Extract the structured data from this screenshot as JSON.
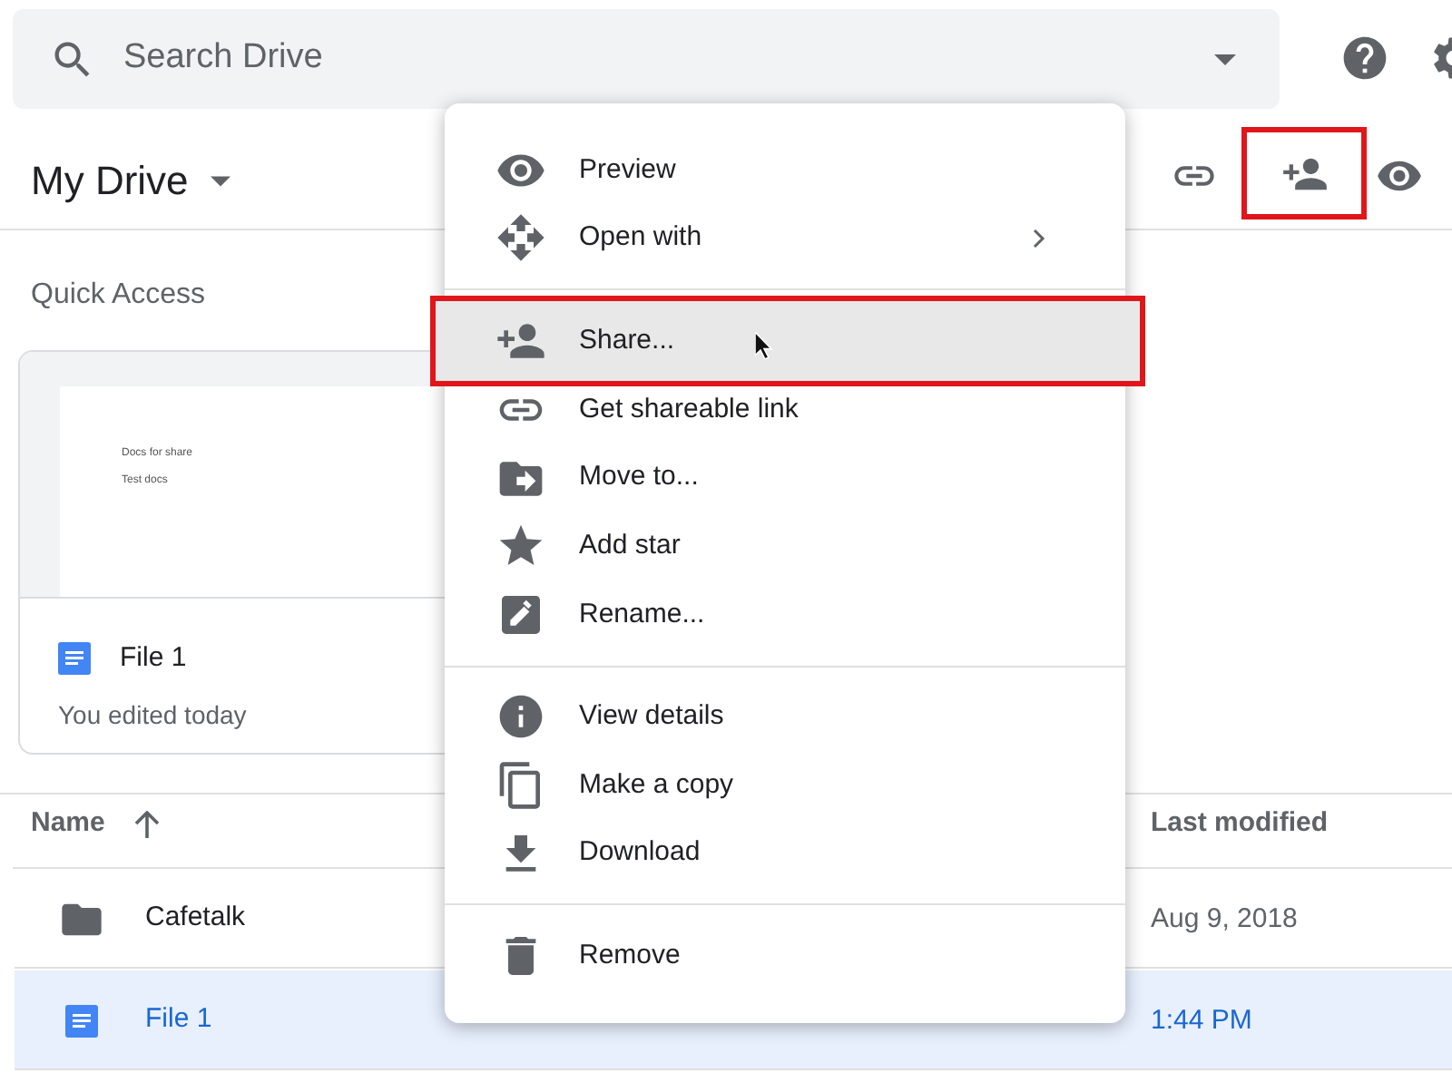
{
  "search": {
    "placeholder": "Search Drive"
  },
  "header_actions": [
    {
      "kind": "help"
    },
    {
      "kind": "settings"
    }
  ],
  "title": "My Drive",
  "toolbar": [
    {
      "kind": "link",
      "highlighted": false
    },
    {
      "kind": "share",
      "highlighted": true
    },
    {
      "kind": "preview",
      "highlighted": false
    }
  ],
  "quick_access": {
    "heading": "Quick Access",
    "cards": [
      {
        "name": "File 1",
        "subtitle": "You edited today",
        "preview_lines": [
          "Docs for share",
          "Test docs"
        ]
      }
    ]
  },
  "table": {
    "columns": [
      {
        "label": "Name",
        "sorted": true
      },
      {
        "label": "Last modified",
        "sorted": false
      }
    ],
    "rows": [
      {
        "kind": "folder",
        "name": "Cafetalk",
        "modified": "Aug 9, 2018",
        "selected": false
      },
      {
        "kind": "doc",
        "name": "File 1",
        "modified": "1:44 PM",
        "selected": true
      }
    ]
  },
  "menu": {
    "groups": [
      [
        {
          "kind": "preview",
          "label": "Preview",
          "submenu": false,
          "hovered": false,
          "highlighted": false
        },
        {
          "kind": "open",
          "label": "Open with",
          "submenu": true,
          "hovered": false,
          "highlighted": false
        }
      ],
      [
        {
          "kind": "share",
          "label": "Share...",
          "submenu": false,
          "hovered": true,
          "highlighted": true
        },
        {
          "kind": "link",
          "label": "Get shareable link",
          "submenu": false,
          "hovered": false,
          "highlighted": false
        },
        {
          "kind": "move",
          "label": "Move to...",
          "submenu": false,
          "hovered": false,
          "highlighted": false
        },
        {
          "kind": "star",
          "label": "Add star",
          "submenu": false,
          "hovered": false,
          "highlighted": false
        },
        {
          "kind": "rename",
          "label": "Rename...",
          "submenu": false,
          "hovered": false,
          "highlighted": false
        }
      ],
      [
        {
          "kind": "info",
          "label": "View details",
          "submenu": false,
          "hovered": false,
          "highlighted": false
        },
        {
          "kind": "copy",
          "label": "Make a copy",
          "submenu": false,
          "hovered": false,
          "highlighted": false
        },
        {
          "kind": "download",
          "label": "Download",
          "submenu": false,
          "hovered": false,
          "highlighted": false
        }
      ],
      [
        {
          "kind": "remove",
          "label": "Remove",
          "submenu": false,
          "hovered": false,
          "highlighted": false
        }
      ]
    ]
  }
}
